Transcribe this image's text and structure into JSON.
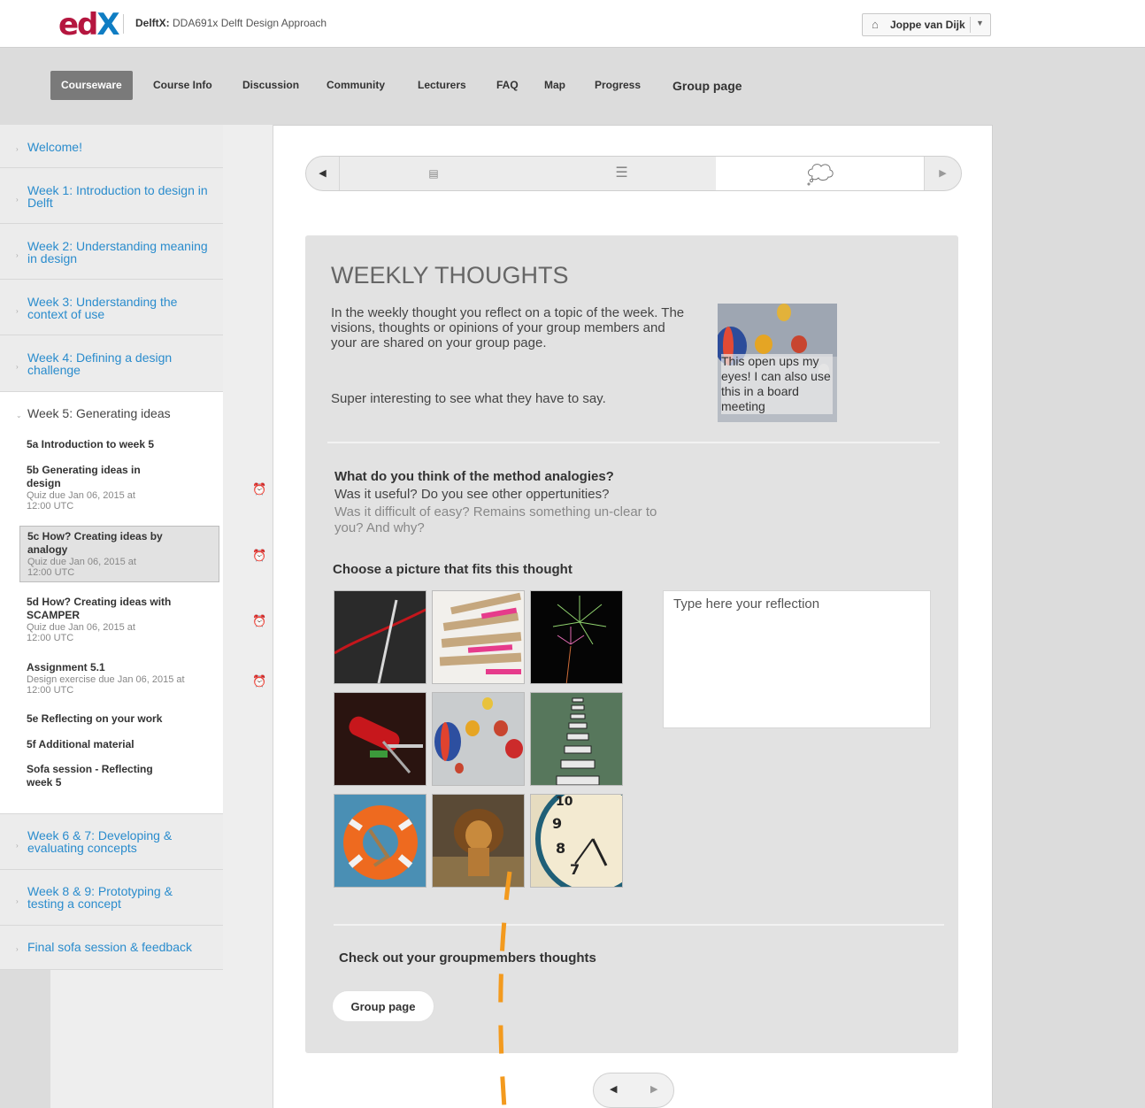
{
  "header": {
    "logo": "edX",
    "course_org": "DelftX:",
    "course_name": "DDA691x Delft Design Approach",
    "user_name": "Joppe van Dijk",
    "home_icon": "home-icon"
  },
  "nav": {
    "courseware": "Courseware",
    "course_info": "Course Info",
    "discussion": "Discussion",
    "community": "Community",
    "lecturers": "Lecturers",
    "faq": "FAQ",
    "map": "Map",
    "progress": "Progress",
    "group_page": "Group page"
  },
  "sidebar": {
    "chapters": [
      "Welcome!",
      "Week 1: Introduction to design in Delft",
      "Week 2: Understanding meaning in design",
      "Week 3: Understanding the context of use",
      "Week 4: Defining a design challenge",
      "Week 5: Generating ideas",
      "Week 6 & 7: Developing & evaluating concepts",
      "Week 8 & 9: Prototyping & testing a concept",
      "Final sofa session & feedback"
    ],
    "subsections": [
      {
        "title": "5a Introduction to week 5",
        "due": ""
      },
      {
        "title": "5b Generating ideas in design",
        "due": "Quiz due Jan 06, 2015 at 12:00 UTC"
      },
      {
        "title": "5c How? Creating ideas by analogy",
        "due": "Quiz due Jan 06, 2015 at 12:00 UTC"
      },
      {
        "title": "5d How? Creating ideas with SCAMPER",
        "due": "Quiz due Jan 06, 2015 at 12:00 UTC"
      },
      {
        "title": "Assignment 5.1",
        "due": "Design exercise due Jan 06, 2015 at 12:00 UTC"
      },
      {
        "title": "5e Reflecting on your work",
        "due": ""
      },
      {
        "title": "5f Additional material",
        "due": ""
      },
      {
        "title": "Sofa session - Reflecting week 5",
        "due": ""
      }
    ]
  },
  "sequence": {
    "tabs": [
      "video-icon",
      "text-icon",
      "thought-bubble-icon"
    ],
    "active_index": 2
  },
  "main": {
    "title": "WEEKLY THOUGHTS",
    "intro": "In the weekly thought you reflect on a topic of the week. The visions, thoughts or opinions of your group members and your are shared on your group page.",
    "intro2": "Super interesting to see what they have to say.",
    "card_caption": "This open ups my eyes! I can also use this in a board meeting",
    "question_bold": "What do you think of the method analogies?",
    "question_text": "Was it useful? Do you see other oppertunities?",
    "question_muted": "Was it difficult of easy? Remains something un-clear to you? And why?",
    "choose_label": "Choose a picture that fits this thought",
    "pictures": [
      "needle-thread",
      "paper-stack",
      "fireworks",
      "pocket-knife",
      "hot-air-balloons",
      "stepping-stones",
      "life-buoy",
      "lion",
      "clock"
    ],
    "reflection_placeholder": "Type here your reflection",
    "checkout_label": "Check out your groupmembers thoughts",
    "group_button": "Group page"
  },
  "colors": {
    "edx_red": "#b5163f",
    "edx_blue": "#0f7dc3",
    "link_blue": "#2a8ccd",
    "annotation_orange": "#f39a1e"
  }
}
